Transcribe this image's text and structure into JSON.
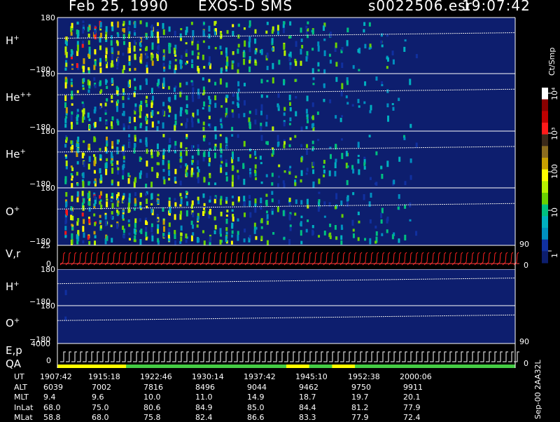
{
  "header": {
    "date": "Feb 25, 1990",
    "instrument": "EXOS-D SMS",
    "file": "s0022506.esr",
    "time": "19:07:42"
  },
  "colorbar": {
    "unit_label": "Ct/Smp",
    "tick_labels": [
      "10⁴",
      "10³",
      "100",
      "10",
      "1"
    ],
    "colors": [
      "#ffffff",
      "#8b0000",
      "#c00000",
      "#ff1a1a",
      "#3b2a1a",
      "#8c6d1f",
      "#c8a000",
      "#ffff00",
      "#b8f000",
      "#6ad000",
      "#00c080",
      "#00b0c0",
      "#0090c0",
      "#1030a0",
      "#0d1e6e"
    ]
  },
  "panels": [
    {
      "id": "H",
      "base": "H",
      "sup": "+",
      "top_tick": "180",
      "bottom_tick": "−180",
      "density": 1.0
    },
    {
      "id": "He2",
      "base": "He",
      "sup": "++",
      "top_tick": "180",
      "bottom_tick": "−180",
      "density": 0.75
    },
    {
      "id": "He1",
      "base": "He",
      "sup": "+",
      "top_tick": "180",
      "bottom_tick": "−180",
      "density": 0.85
    },
    {
      "id": "O",
      "base": "O",
      "sup": "+",
      "top_tick": "180",
      "bottom_tick": "−180",
      "density": 1.0
    },
    {
      "id": "H2",
      "base": "H",
      "sup": "+",
      "top_tick": "180",
      "bottom_tick": "−180",
      "density": 0.1
    },
    {
      "id": "O2",
      "base": "O",
      "sup": "+",
      "top_tick": "180",
      "bottom_tick": "−180",
      "density": 0.05
    }
  ],
  "vr_panel": {
    "label": "V,r",
    "top_tick": "25",
    "zero_tick": "0",
    "right_top": "90",
    "right_zero": "0"
  },
  "ep_panel": {
    "label": "E,p",
    "qa_label": "QA",
    "top_tick": "4000",
    "zero_tick": "0",
    "right_top": "90",
    "right_zero": "0"
  },
  "side_label": "Sep-00 2AA32L",
  "chart_data": {
    "type": "heatmap",
    "title": "Feb 25, 1990 EXOS-D SMS",
    "x": [
      "1907:42",
      "1915:18",
      "1922:46",
      "1930:14",
      "1937:42",
      "1945:10",
      "1952:38",
      "2000:06"
    ],
    "y_range": [
      -180,
      180
    ],
    "color_scale": "log",
    "color_range": [
      1,
      10000
    ],
    "color_unit": "Ct/Smp",
    "orbit_table": {
      "rows": [
        {
          "label": "UT",
          "values": [
            "1907:42",
            "1915:18",
            "1922:46",
            "1930:14",
            "1937:42",
            "1945:10",
            "1952:38",
            "2000:06"
          ]
        },
        {
          "label": "ALT",
          "values": [
            "6039",
            "7002",
            "7816",
            "8496",
            "9044",
            "9462",
            "9750",
            "9911"
          ]
        },
        {
          "label": "MLT",
          "values": [
            "9.4",
            "9.6",
            "10.0",
            "11.0",
            "14.9",
            "18.7",
            "19.7",
            "20.1"
          ]
        },
        {
          "label": "InLat",
          "values": [
            "68.0",
            "75.0",
            "80.6",
            "84.9",
            "85.0",
            "84.4",
            "81.2",
            "77.9"
          ]
        },
        {
          "label": "MLat",
          "values": [
            "58.8",
            "68.0",
            "75.8",
            "82.4",
            "86.6",
            "83.3",
            "77.9",
            "72.4"
          ]
        }
      ]
    }
  }
}
